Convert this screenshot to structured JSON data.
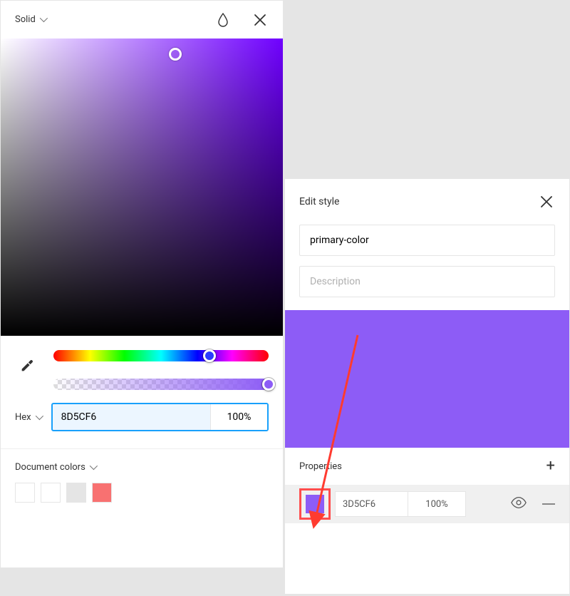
{
  "picker": {
    "mode_label": "Solid",
    "hex_format_label": "Hex",
    "hex_value": "8D5CF6",
    "opacity_value": "100%",
    "doc_colors_label": "Document colors",
    "swatches": [
      "#ffffff",
      "#ffffff",
      "#e5e5e5",
      "#f87171"
    ],
    "selected_color": "#8D5CF6",
    "hue_color": "#6f00ff"
  },
  "style": {
    "title": "Edit style",
    "name_value": "primary-color",
    "description_placeholder": "Description",
    "big_swatch_color": "#8D5CF6",
    "properties_label": "Properties",
    "prop_swatch_color": "#8D5CF6",
    "prop_hex": "3D5CF6",
    "prop_opacity": "100%"
  },
  "annotation": {
    "color": "#ff3b30"
  }
}
